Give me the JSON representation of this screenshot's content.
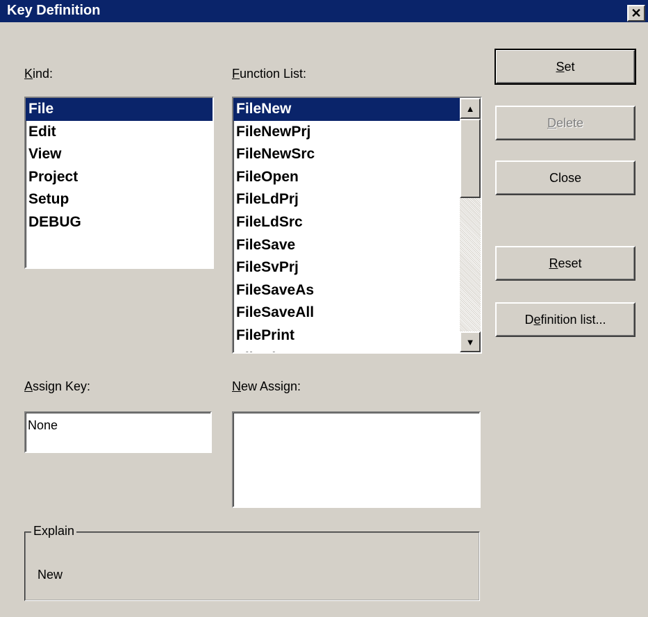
{
  "window": {
    "title": "Key Definition",
    "close_glyph": "✕"
  },
  "kind": {
    "label_mnemonic": "K",
    "label_rest": "ind:",
    "items": [
      "File",
      "Edit",
      "View",
      "Project",
      "Setup",
      "DEBUG"
    ],
    "selected": "File"
  },
  "function_list": {
    "label_mnemonic": "F",
    "label_rest": "unction List:",
    "items": [
      "FileNew",
      "FileNewPrj",
      "FileNewSrc",
      "FileOpen",
      "FileLdPrj",
      "FileLdSrc",
      "FileSave",
      "FileSvPrj",
      "FileSaveAs",
      "FileSaveAll",
      "FilePrint",
      "FileCl"
    ],
    "selected": "FileNew",
    "scroll_up_glyph": "▲",
    "scroll_down_glyph": "▼"
  },
  "buttons": {
    "set": {
      "mnemonic": "S",
      "rest": "et"
    },
    "delete": {
      "mnemonic": "D",
      "rest": "elete",
      "enabled": false
    },
    "close": {
      "label": "Close"
    },
    "reset": {
      "mnemonic": "R",
      "rest": "eset"
    },
    "definition_list": {
      "pre": "D",
      "mnemonic": "e",
      "rest": "finition list..."
    }
  },
  "assign_key": {
    "label_mnemonic": "A",
    "label_rest": "ssign Key:",
    "value": "None"
  },
  "new_assign": {
    "label_mnemonic": "N",
    "label_rest": "ew Assign:",
    "value": ""
  },
  "explain": {
    "title": "Explain",
    "text": "New"
  },
  "colors": {
    "titlebar": "#0a246a",
    "selection": "#0a246a",
    "face": "#d4d0c8"
  }
}
